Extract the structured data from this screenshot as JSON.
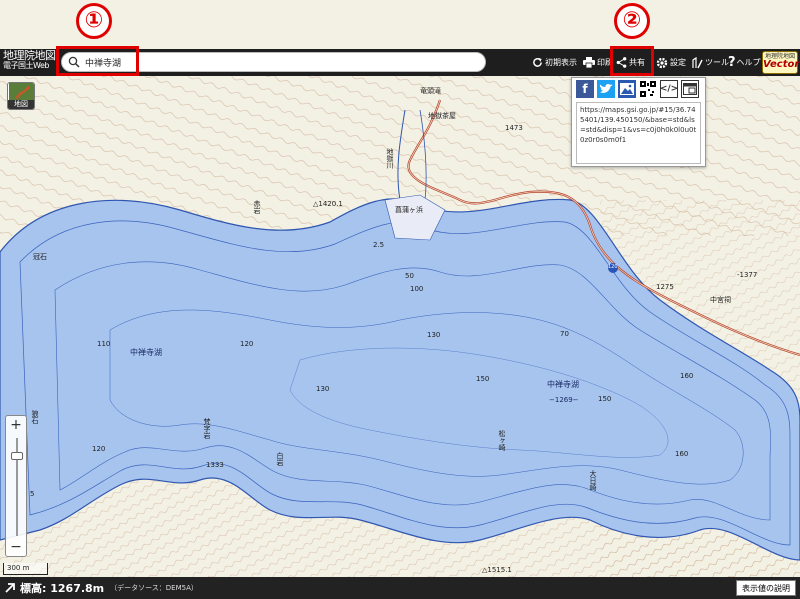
{
  "app": {
    "logo_line1": "地理院地図",
    "logo_line2": "電子国土Web",
    "vector_small": "地理院地図",
    "vector_big": "Vector"
  },
  "search": {
    "value": "中禅寺湖",
    "placeholder": ""
  },
  "toolbar": {
    "reset_label": "初期表示",
    "print_label": "印刷",
    "share_label": "共有",
    "settings_label": "設定",
    "tools_label": "ツール",
    "help_label": "ヘルプ"
  },
  "annotations": {
    "badge1": "①",
    "badge2": "②"
  },
  "share": {
    "url": "https://maps.gsi.go.jp/#15/36.745401/139.450150/&base=std&ls=std&disp=1&vs=c0j0h0k0l0u0t0z0r0s0m0f1",
    "icons": [
      "facebook-icon",
      "twitter-icon",
      "image-icon",
      "qrcode-icon",
      "embed-code-icon",
      "window-icon"
    ]
  },
  "layer_button": {
    "label": "地図"
  },
  "map_labels": {
    "waterfall": "竜頭滝",
    "teahouse": "地獄茶屋",
    "river": "地獄川",
    "lake_main": "中禅寺湖",
    "lake_second": "中禅寺湖",
    "lake_elev": "−1269−",
    "shrine": "中宮祠",
    "kanzaki": "菖蒲ヶ浜",
    "rock_akaiwa": "赤岩",
    "rock_kanzaki": "冠石",
    "tsumuga": "梵字岩",
    "shiraiwa": "白岩",
    "matsugasaki": "松ヶ崎",
    "ojirisaki": "大日崎",
    "sinkai": "狼石",
    "spot1420": "△1420.1",
    "spot1473": "1473",
    "spot1377": "-1377",
    "spot1275": "1275",
    "spot1333": "1333",
    "spot1515": "△1515.1",
    "route120": "120",
    "depth": [
      "50",
      "100",
      "110",
      "120",
      "130",
      "130",
      "150",
      "150",
      "160",
      "160",
      "120",
      "2.5",
      "70",
      "5"
    ]
  },
  "zoom": {
    "in_label": "+",
    "out_label": "−"
  },
  "scale": {
    "label": "300 m"
  },
  "status": {
    "elevation": "標高: 1267.8m",
    "source": "（データソース：DEM5A）",
    "explain_button": "表示値の説明"
  },
  "colors": {
    "accent_red": "#e00000",
    "lake": "#a8c6ee",
    "land": "#f2efe3",
    "topbar": "#1e1e1e"
  }
}
